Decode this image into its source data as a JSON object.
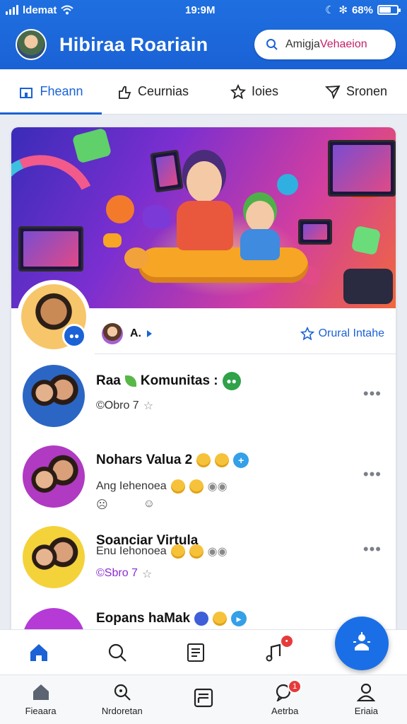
{
  "status_bar": {
    "carrier": "ldemat",
    "time": "19:9M",
    "battery": "68%"
  },
  "header": {
    "title": "Hibiraa Roariain",
    "search_placeholder_a": "Amigja",
    "search_placeholder_b": "Vehaeion"
  },
  "tabs": [
    {
      "label": "Fheann",
      "icon": "home-outline-icon",
      "active": true
    },
    {
      "label": "Ceurnias",
      "icon": "hand-icon",
      "active": false
    },
    {
      "label": "Ioies",
      "icon": "star-icon",
      "active": false
    },
    {
      "label": "Sronen",
      "icon": "send-icon",
      "active": false
    }
  ],
  "profile": {
    "name": "A.",
    "favorite_label": "Orural Intahe"
  },
  "list": [
    {
      "name": "Raa",
      "name2": "Komunitas :",
      "sub": "©Obro 7",
      "sub_style": "normal"
    },
    {
      "name": "Nohars Valua 2",
      "sub": "Ang Iehenoea"
    },
    {
      "name": "Soanciar Virtula",
      "sub": "Enu Iehonoea",
      "sub2": "©Sbro 7"
    },
    {
      "name": "Eopans haMak",
      "sub": ""
    }
  ],
  "bottom_nav": [
    {
      "label": "Fieaara",
      "icon": "home-icon",
      "active": false
    },
    {
      "label": "Nrdoretan",
      "icon": "search-icon",
      "active": false
    },
    {
      "label": "",
      "icon": "news-icon",
      "active": false
    },
    {
      "label": "Aetrba",
      "icon": "chat-icon",
      "active": false
    },
    {
      "label": "Eriaia",
      "icon": "person-icon",
      "active": false
    }
  ],
  "colors": {
    "brand": "#1a62d6",
    "accent": "#c4206a"
  }
}
